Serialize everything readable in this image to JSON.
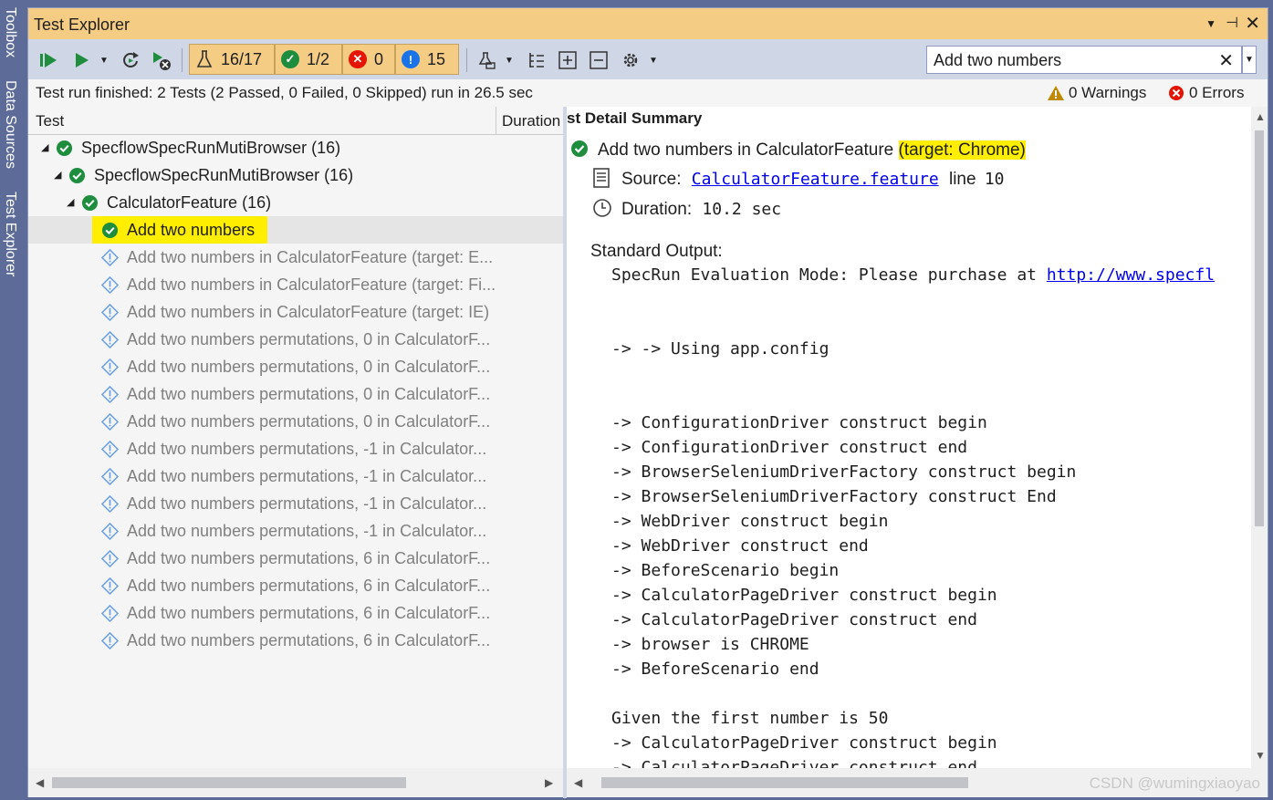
{
  "side_tabs": [
    "Toolbox",
    "Data Sources",
    "Test Explorer"
  ],
  "window": {
    "title": "Test Explorer"
  },
  "toolbar": {
    "filters": {
      "total": "16/17",
      "passed": "1/2",
      "failed": "0",
      "not_run": "15"
    },
    "search_value": "Add two numbers"
  },
  "status": {
    "message": "Test run finished: 2 Tests (2 Passed, 0 Failed, 0 Skipped) run in 26.5 sec",
    "warnings": "0 Warnings",
    "errors": "0 Errors"
  },
  "tree": {
    "col_test": "Test",
    "col_duration": "Duration",
    "rows": [
      {
        "label": "SpecflowSpecRunMutiBrowser  (16)"
      },
      {
        "label": "SpecflowSpecRunMutiBrowser  (16)"
      },
      {
        "label": "CalculatorFeature  (16)"
      },
      {
        "label": "Add two numbers"
      },
      {
        "label": "Add two numbers in CalculatorFeature (target: E..."
      },
      {
        "label": "Add two numbers in CalculatorFeature (target: Fi..."
      },
      {
        "label": "Add two numbers in CalculatorFeature (target: IE)"
      },
      {
        "label": "Add two numbers permutations, 0 in CalculatorF..."
      },
      {
        "label": "Add two numbers permutations, 0 in CalculatorF..."
      },
      {
        "label": "Add two numbers permutations, 0 in CalculatorF..."
      },
      {
        "label": "Add two numbers permutations, 0 in CalculatorF..."
      },
      {
        "label": "Add two numbers permutations, -1 in Calculator..."
      },
      {
        "label": "Add two numbers permutations, -1 in Calculator..."
      },
      {
        "label": "Add two numbers permutations, -1 in Calculator..."
      },
      {
        "label": "Add two numbers permutations, -1 in Calculator..."
      },
      {
        "label": "Add two numbers permutations, 6 in CalculatorF..."
      },
      {
        "label": "Add two numbers permutations, 6 in CalculatorF..."
      },
      {
        "label": "Add two numbers permutations, 6 in CalculatorF..."
      },
      {
        "label": "Add two numbers permutations, 6 in CalculatorF..."
      }
    ]
  },
  "detail": {
    "header": "st Detail Summary",
    "test_name": "Add two numbers in CalculatorFeature",
    "target": "(target: Chrome)",
    "source_label": "Source:",
    "source_link": "CalculatorFeature.feature",
    "line_label": "line",
    "line_no": "10",
    "duration_label": "Duration:",
    "duration_value": "10.2 sec",
    "stdout_label": "Standard Output:",
    "output_lines": [
      {
        "text": "SpecRun Evaluation Mode: Please purchase at ",
        "link": "http://www.specfl"
      },
      {
        "text": ""
      },
      {
        "text": ""
      },
      {
        "text": "-> -> Using app.config"
      },
      {
        "text": ""
      },
      {
        "text": ""
      },
      {
        "text": "-> ConfigurationDriver construct begin"
      },
      {
        "text": "-> ConfigurationDriver construct end"
      },
      {
        "text": "-> BrowserSeleniumDriverFactory construct begin"
      },
      {
        "text": "-> BrowserSeleniumDriverFactory construct End"
      },
      {
        "text": "-> WebDriver construct begin"
      },
      {
        "text": "-> WebDriver construct end"
      },
      {
        "text": "-> BeforeScenario begin"
      },
      {
        "text": "-> CalculatorPageDriver construct begin"
      },
      {
        "text": "-> CalculatorPageDriver construct end"
      },
      {
        "text": "-> browser is CHROME"
      },
      {
        "text": "-> BeforeScenario end"
      },
      {
        "text": ""
      },
      {
        "text": "Given the first number is 50"
      },
      {
        "text": "-> CalculatorPageDriver construct begin"
      },
      {
        "text": "-> CalculatorPageDriver construct end"
      }
    ]
  },
  "watermark": "CSDN @wumingxiaoyao",
  "colors": {
    "pass": "#1e8e3e",
    "fail": "#e51400",
    "info": "#1a73e8",
    "highlight": "#ffee00",
    "title_bar": "#f5cc84"
  }
}
